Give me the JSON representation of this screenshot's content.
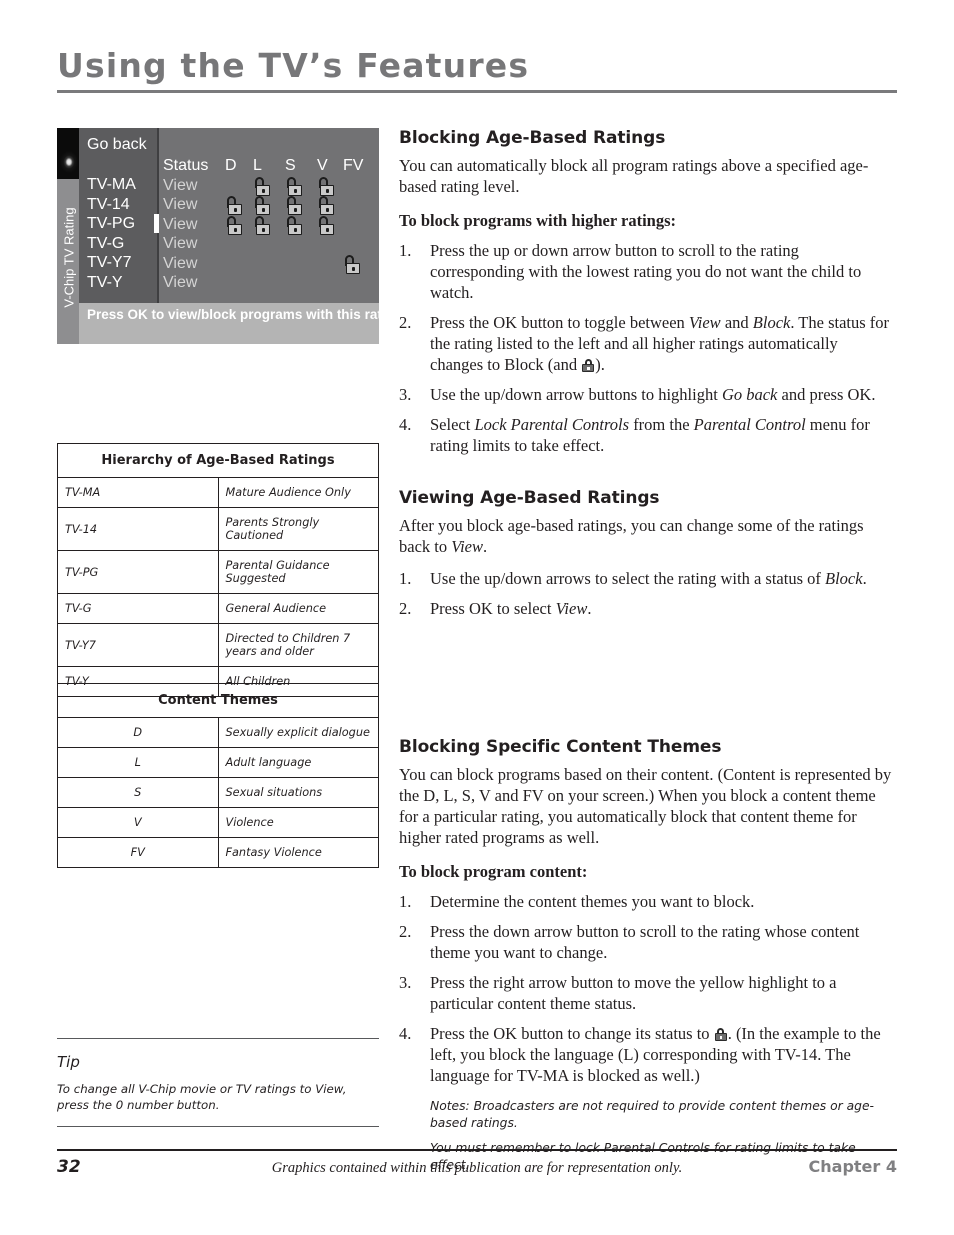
{
  "page": {
    "title": "Using the TV’s Features",
    "number": "32",
    "footer_note": "Graphics contained within this publication are for representation only.",
    "chapter": "Chapter 4"
  },
  "tv_screen": {
    "sidebar_label": "V-Chip TV Rating",
    "go_back": "Go back",
    "columns": [
      "Status",
      "D",
      "L",
      "S",
      "V",
      "FV"
    ],
    "rows": [
      {
        "rating": "TV-MA",
        "status": "View",
        "locks": [
          "",
          "L",
          "S",
          "V"
        ]
      },
      {
        "rating": "TV-14",
        "status": "View",
        "locks": [
          "D",
          "L",
          "S",
          "V"
        ]
      },
      {
        "rating": "TV-PG",
        "status": "View",
        "locks": [
          "D",
          "L",
          "S",
          "V"
        ]
      },
      {
        "rating": "TV-G",
        "status": "View",
        "locks": []
      },
      {
        "rating": "TV-Y7",
        "status": "View",
        "locks": [
          "FV"
        ]
      },
      {
        "rating": "TV-Y",
        "status": "View",
        "locks": []
      }
    ],
    "bottom_bar": "Press OK to view/block programs with this rating",
    "cursor_on_rating": "TV-PG",
    "colors": {
      "sidebar": "#8e8e90",
      "menu_left": "#5c5c5e",
      "menu_right": "#727274",
      "bottom_bar": "#b4b4b4",
      "screen_bg": "#a8a8a8"
    }
  },
  "table_hierarchy": {
    "title": "Hierarchy of Age-Based Ratings",
    "rows": [
      {
        "code": "TV-MA",
        "desc": "Mature Audience Only"
      },
      {
        "code": "TV-14",
        "desc": "Parents Strongly Cautioned"
      },
      {
        "code": "TV-PG",
        "desc": "Parental Guidance Suggested"
      },
      {
        "code": "TV-G",
        "desc": "General Audience"
      },
      {
        "code": "TV-Y7",
        "desc": "Directed to Children 7 years and older"
      },
      {
        "code": "TV-Y",
        "desc": "All Children"
      }
    ]
  },
  "table_themes": {
    "title": "Content Themes",
    "rows": [
      {
        "code": "D",
        "desc": "Sexually explicit dialogue"
      },
      {
        "code": "L",
        "desc": "Adult language"
      },
      {
        "code": "S",
        "desc": "Sexual situations"
      },
      {
        "code": "V",
        "desc": "Violence"
      },
      {
        "code": "FV",
        "desc": "Fantasy Violence"
      }
    ]
  },
  "tip": {
    "label": "Tip",
    "text": "To change all V-Chip movie or TV ratings to View, press the 0 number button."
  },
  "section_blocking_age": {
    "heading": "Blocking Age-Based Ratings",
    "intro": "You can automatically block all program ratings above a specified age-based rating level.",
    "sub_heading": "To block programs with higher ratings:",
    "step1_num": "1.",
    "step1": "Press the up or down arrow button to scroll to the rating corresponding with the lowest rating you do not want the child to watch.",
    "step2_num": "2.",
    "step2_a": "Press the OK button to toggle between ",
    "step2_view": "View",
    "step2_b": " and ",
    "step2_block": "Block",
    "step2_c": ". The status for the rating listed to the left and all higher ratings automatically changes to Block (and ",
    "step2_d": ").",
    "step3_num": "3.",
    "step3_a": "Use the up/down arrow buttons to highlight ",
    "step3_goback": "Go back",
    "step3_b": " and press OK.",
    "step4_num": "4.",
    "step4_a": "Select ",
    "step4_lock": "Lock Parental Controls",
    "step4_b": " from the ",
    "step4_pc": "Parental Control",
    "step4_c": " menu for rating limits to take effect."
  },
  "section_viewing_age": {
    "heading": "Viewing Age-Based Ratings",
    "intro_a": "After you block age-based ratings, you can change some of the ratings back to ",
    "intro_view": "View",
    "intro_b": ".",
    "step1_num": "1.",
    "step1_a": "Use the up/down arrows to select the rating with a status of ",
    "step1_block": "Block",
    "step1_b": ".",
    "step2_num": "2.",
    "step2_a": "Press OK to select ",
    "step2_view": "View",
    "step2_b": "."
  },
  "section_content_themes": {
    "heading": "Blocking Specific Content Themes",
    "intro": "You can block programs based on their content. (Content is represented by the D, L, S, V and FV on your screen.) When you block a content theme for a particular rating, you automatically block that content theme for higher rated programs as well.",
    "sub_heading": "To block program content:",
    "step1_num": "1.",
    "step1": "Determine the content themes you want to block.",
    "step2_num": "2.",
    "step2": "Press the down arrow button to scroll to the rating whose content theme you want to change.",
    "step3_num": "3.",
    "step3": "Press the right arrow button to move the yellow highlight to a particular content theme status.",
    "step4_num": "4.",
    "step4_a": "Press the OK button to change its status to ",
    "step4_b": ". (In the example to the left, you block the language (L) corresponding with TV-14. The language for TV-MA is blocked as well.)",
    "note1": "Notes: Broadcasters are not required to provide content themes or age-based ratings.",
    "note2": "You must remember to lock Parental Controls for rating limits to take effect."
  }
}
